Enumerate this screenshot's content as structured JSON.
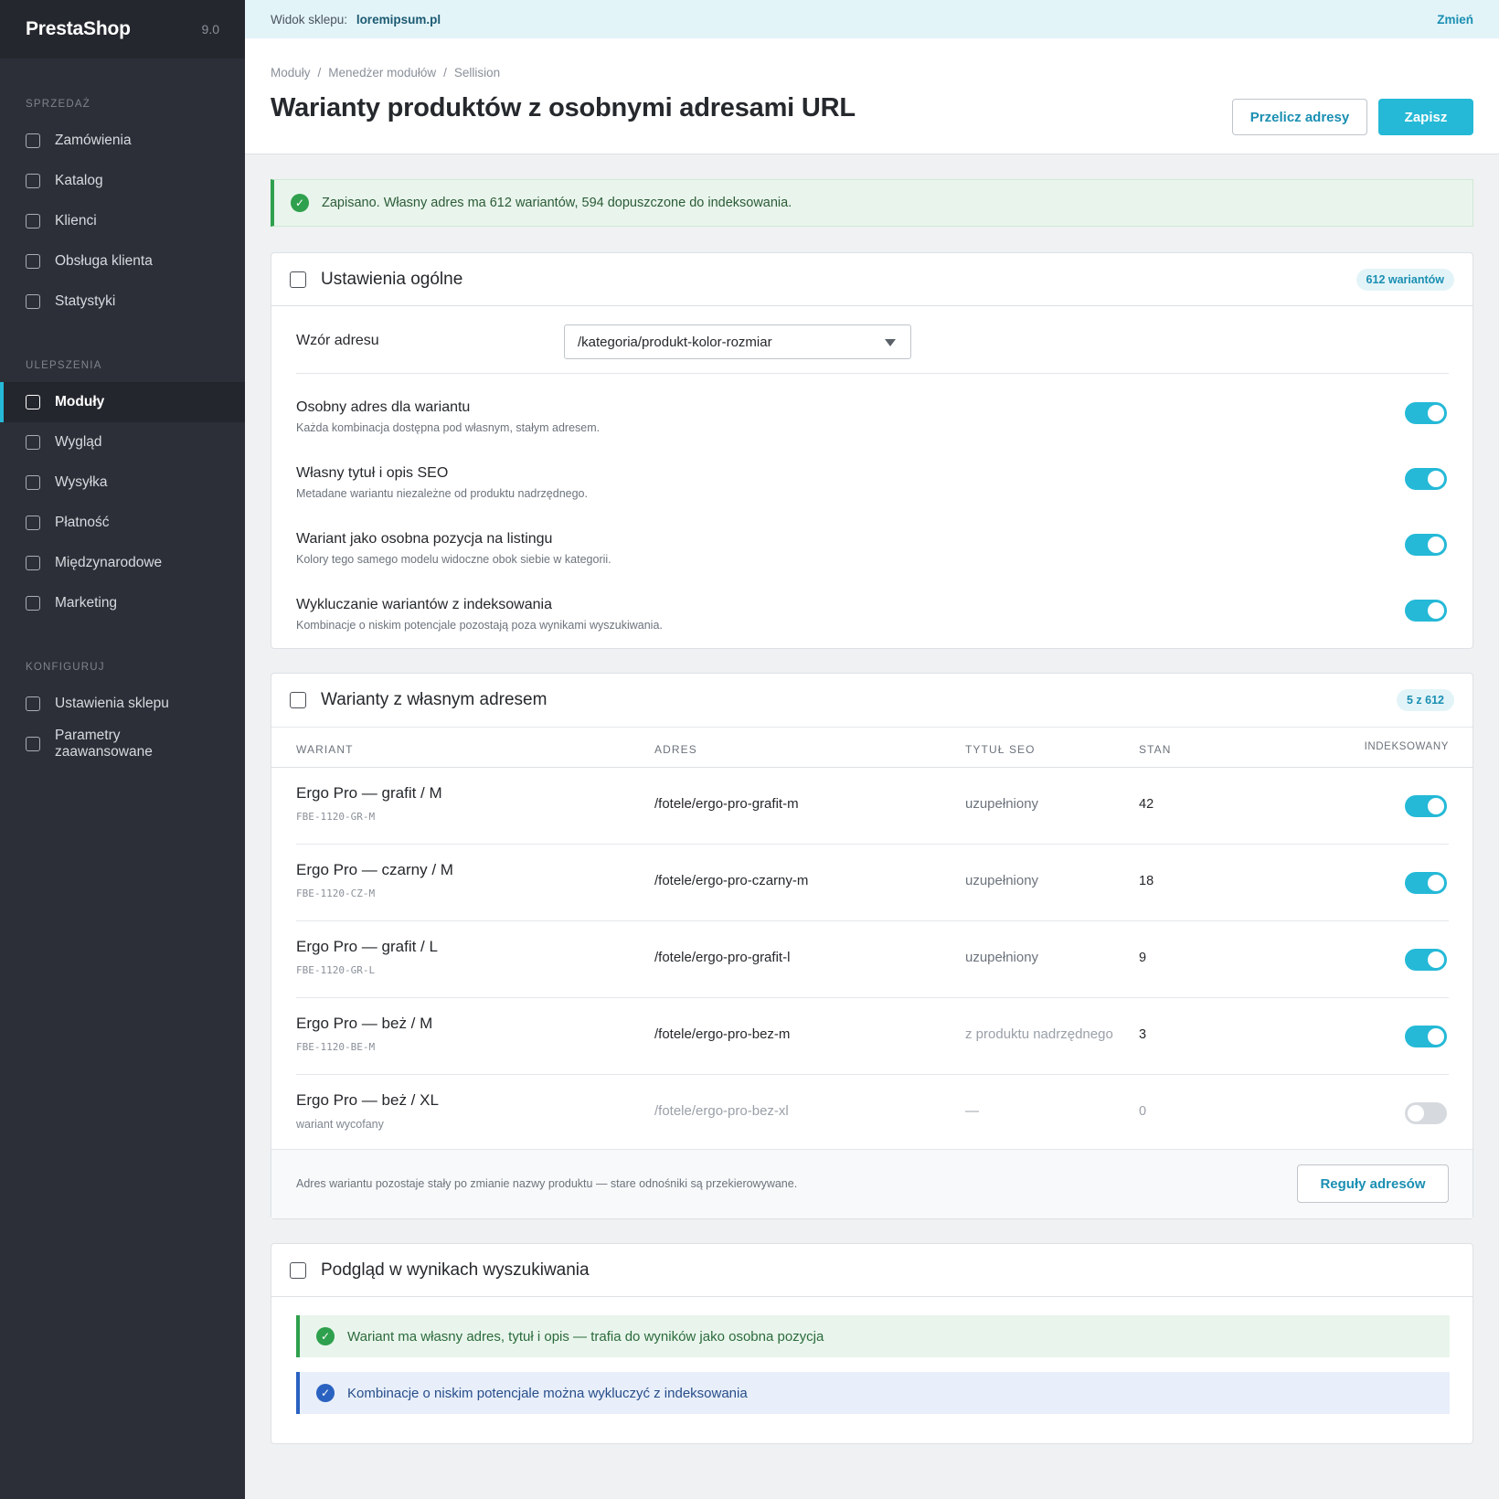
{
  "sidebar": {
    "brand": "PrestaShop",
    "version": "9.0",
    "groups": [
      {
        "title": "SPRZEDAŻ",
        "items": [
          "Zamówienia",
          "Katalog",
          "Klienci",
          "Obsługa klienta",
          "Statystyki"
        ]
      },
      {
        "title": "ULEPSZENIA",
        "items": [
          "Moduły",
          "Wygląd",
          "Wysyłka",
          "Płatność",
          "Międzynarodowe",
          "Marketing"
        ]
      },
      {
        "title": "KONFIGURUJ",
        "items": [
          "Ustawienia sklepu",
          "Parametry zaawansowane"
        ]
      }
    ],
    "active_item": "Moduły"
  },
  "shopbar": {
    "label": "Widok sklepu:",
    "shop": "loremipsum.pl",
    "change": "Zmień"
  },
  "header": {
    "breadcrumb": [
      "Moduły",
      "Menedżer modułów",
      "Sellision"
    ],
    "title": "Warianty produktów z osobnymi adresami URL",
    "recalc_label": "Przelicz adresy",
    "save_label": "Zapisz"
  },
  "alert": {
    "text": "Zapisano. Własny adres ma 612 wariantów, 594 dopuszczone do indeksowania."
  },
  "general": {
    "title": "Ustawienia ogólne",
    "badge": "612 wariantów",
    "pattern_label": "Wzór adresu",
    "pattern_value": "/kategoria/produkt-kolor-rozmiar",
    "options": [
      {
        "title": "Osobny adres dla wariantu",
        "desc": "Każda kombinacja dostępna pod własnym, stałym adresem.",
        "enabled": true
      },
      {
        "title": "Własny tytuł i opis SEO",
        "desc": "Metadane wariantu niezależne od produktu nadrzędnego.",
        "enabled": true
      },
      {
        "title": "Wariant jako osobna pozycja na listingu",
        "desc": "Kolory tego samego modelu widoczne obok siebie w kategorii.",
        "enabled": true
      },
      {
        "title": "Wykluczanie wariantów z indeksowania",
        "desc": "Kombinacje o niskim potencjale pozostają poza wynikami wyszukiwania.",
        "enabled": true
      }
    ]
  },
  "variants": {
    "title": "Warianty z własnym adresem",
    "badge": "5 z 612",
    "columns": [
      "WARIANT",
      "ADRES",
      "TYTUŁ SEO",
      "STAN",
      "INDEKSOWANY"
    ],
    "rows": [
      {
        "name": "Ergo Pro — grafit / M",
        "sub": "FBE-1120-GR-M",
        "url": "/fotele/ergo-pro-grafit-m",
        "seo": "uzupełniony",
        "stock": "42",
        "indexed": true
      },
      {
        "name": "Ergo Pro — czarny / M",
        "sub": "FBE-1120-CZ-M",
        "url": "/fotele/ergo-pro-czarny-m",
        "seo": "uzupełniony",
        "stock": "18",
        "indexed": true
      },
      {
        "name": "Ergo Pro — grafit / L",
        "sub": "FBE-1120-GR-L",
        "url": "/fotele/ergo-pro-grafit-l",
        "seo": "uzupełniony",
        "stock": "9",
        "indexed": true
      },
      {
        "name": "Ergo Pro — beż / M",
        "sub": "FBE-1120-BE-M",
        "url": "/fotele/ergo-pro-bez-m",
        "seo": "z produktu nadrzędnego",
        "stock": "3",
        "indexed": true
      },
      {
        "name": "Ergo Pro — beż / XL",
        "sub": "wariant wycofany",
        "url": "/fotele/ergo-pro-bez-xl",
        "seo": "—",
        "stock": "0",
        "indexed": false
      }
    ],
    "footer_note": "Adres wariantu pozostaje stały po zmianie nazwy produktu — stare odnośniki są przekierowywane.",
    "rules_label": "Reguły adresów"
  },
  "preview": {
    "title": "Podgląd w wynikach wyszukiwania",
    "alerts": [
      {
        "text": "Wariant ma własny adres, tytuł i opis — trafia do wyników jako osobna pozycja",
        "color": "#2fa04d"
      },
      {
        "text": "Kombinacje o niskim potencjale można wykluczyć z indeksowania",
        "color": "#2a62c1"
      }
    ]
  },
  "colors": {
    "accent": "#25b9d7",
    "sidebar": "#2c2f38",
    "success": "#2fa04d",
    "info": "#2a62c1"
  }
}
